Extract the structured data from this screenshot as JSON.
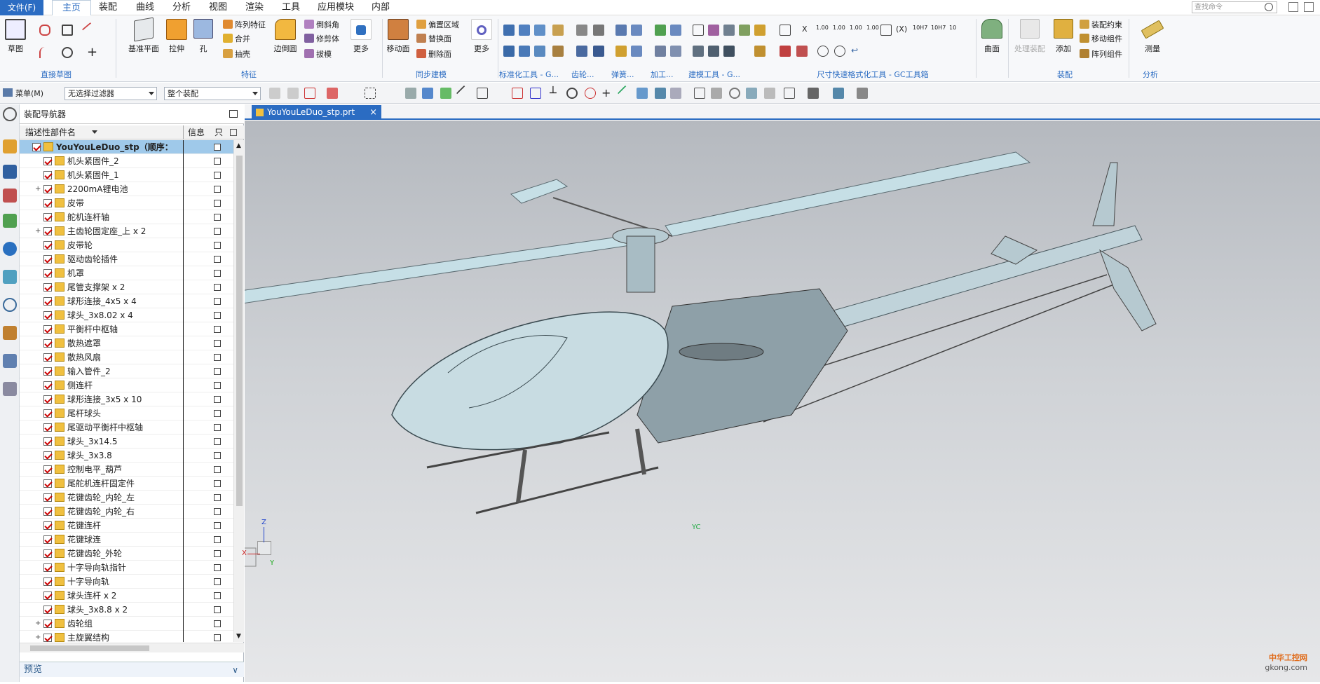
{
  "menu": {
    "file": "文件(F)",
    "items": [
      "主页",
      "装配",
      "曲线",
      "分析",
      "视图",
      "渲染",
      "工具",
      "应用模块",
      "内部"
    ],
    "active": "主页",
    "search_placeholder": "查找命令"
  },
  "ribbon": {
    "sketch": "草图",
    "direct_sketch": "直接草图",
    "datum_plane": "基准平面",
    "extrude": "拉伸",
    "hole": "孔",
    "pattern_feature": "阵列特征",
    "unite": "合并",
    "shell": "抽壳",
    "edge_blend": "边倒圆",
    "chamfer": "倒斜角",
    "trim_body": "修剪体",
    "draft": "拔模",
    "more1": "更多",
    "feature": "特征",
    "move_face": "移动面",
    "offset_region": "偏置区域",
    "replace_face": "替换面",
    "delete_face": "删除面",
    "more2": "更多",
    "sync_modeling": "同步建模",
    "std_tools": "标准化工具 - G...",
    "gear": "齿轮...",
    "spring": "弹簧...",
    "machining": "加工...",
    "modeling_tools": "建模工具 - G...",
    "dim_tools": "尺寸快速格式化工具 - GC工具箱",
    "surface": "曲面",
    "wave": "处理装配",
    "add": "添加",
    "assembly_constraint": "装配约束",
    "move_component": "移动组件",
    "pattern_component": "阵列组件",
    "assembly": "装配",
    "measure": "测量",
    "analysis": "分析",
    "dim_labels": [
      "X",
      "1.00",
      "1.00",
      "1.00",
      "1.00",
      "(X)",
      "10H7",
      "10H7",
      "10"
    ]
  },
  "toolbar2": {
    "menu": "菜单(M)",
    "filter": "无选择过滤器",
    "scope": "整个装配"
  },
  "navigator": {
    "title": "装配导航器",
    "col_name": "描述性部件名",
    "col_info": "信息",
    "col_readonly": "只",
    "root": "YouYouLeDuo_stp（顺序：...",
    "items": [
      {
        "label": "机头紧固件_2",
        "expand": ""
      },
      {
        "label": "机头紧固件_1",
        "expand": ""
      },
      {
        "label": "2200mA锂电池",
        "expand": "+"
      },
      {
        "label": "皮带",
        "expand": ""
      },
      {
        "label": "舵机连杆轴",
        "expand": ""
      },
      {
        "label": "主齿轮固定座_上 x 2",
        "expand": "+"
      },
      {
        "label": "皮带轮",
        "expand": ""
      },
      {
        "label": "驱动齿轮插件",
        "expand": ""
      },
      {
        "label": "机罩",
        "expand": ""
      },
      {
        "label": "尾管支撑架 x 2",
        "expand": ""
      },
      {
        "label": "球形连接_4x5 x 4",
        "expand": ""
      },
      {
        "label": "球头_3x8.02 x 4",
        "expand": ""
      },
      {
        "label": "平衡杆中枢轴",
        "expand": ""
      },
      {
        "label": "散热遮罩",
        "expand": ""
      },
      {
        "label": "散热风扇",
        "expand": ""
      },
      {
        "label": "输入管件_2",
        "expand": ""
      },
      {
        "label": "侧连杆",
        "expand": ""
      },
      {
        "label": "球形连接_3x5 x 10",
        "expand": ""
      },
      {
        "label": "尾杆球头",
        "expand": ""
      },
      {
        "label": "尾驱动平衡杆中枢轴",
        "expand": ""
      },
      {
        "label": "球头_3x14.5",
        "expand": ""
      },
      {
        "label": "球头_3x3.8",
        "expand": ""
      },
      {
        "label": "控制电平_葫芦",
        "expand": ""
      },
      {
        "label": "尾舵机连杆固定件",
        "expand": ""
      },
      {
        "label": "花键齿轮_内轮_左",
        "expand": ""
      },
      {
        "label": "花键齿轮_内轮_右",
        "expand": ""
      },
      {
        "label": "花键连杆",
        "expand": ""
      },
      {
        "label": "花键球连",
        "expand": ""
      },
      {
        "label": "花键齿轮_外轮",
        "expand": ""
      },
      {
        "label": "十字导向轨指针",
        "expand": ""
      },
      {
        "label": "十字导向轨",
        "expand": ""
      },
      {
        "label": "球头连杆 x 2",
        "expand": ""
      },
      {
        "label": "球头_3x8.8 x 2",
        "expand": ""
      },
      {
        "label": "齿轮组",
        "expand": "+"
      },
      {
        "label": "主旋翼结构",
        "expand": "+"
      }
    ],
    "preview": "预览"
  },
  "viewport": {
    "tab": "YouYouLeDuo_stp.prt",
    "tab_close": "×",
    "axis_x": "X",
    "axis_y": "Y",
    "axis_z": "Z",
    "axis_yc": "YC",
    "watermark1": "中华工控网",
    "watermark2": "gkong.com"
  }
}
